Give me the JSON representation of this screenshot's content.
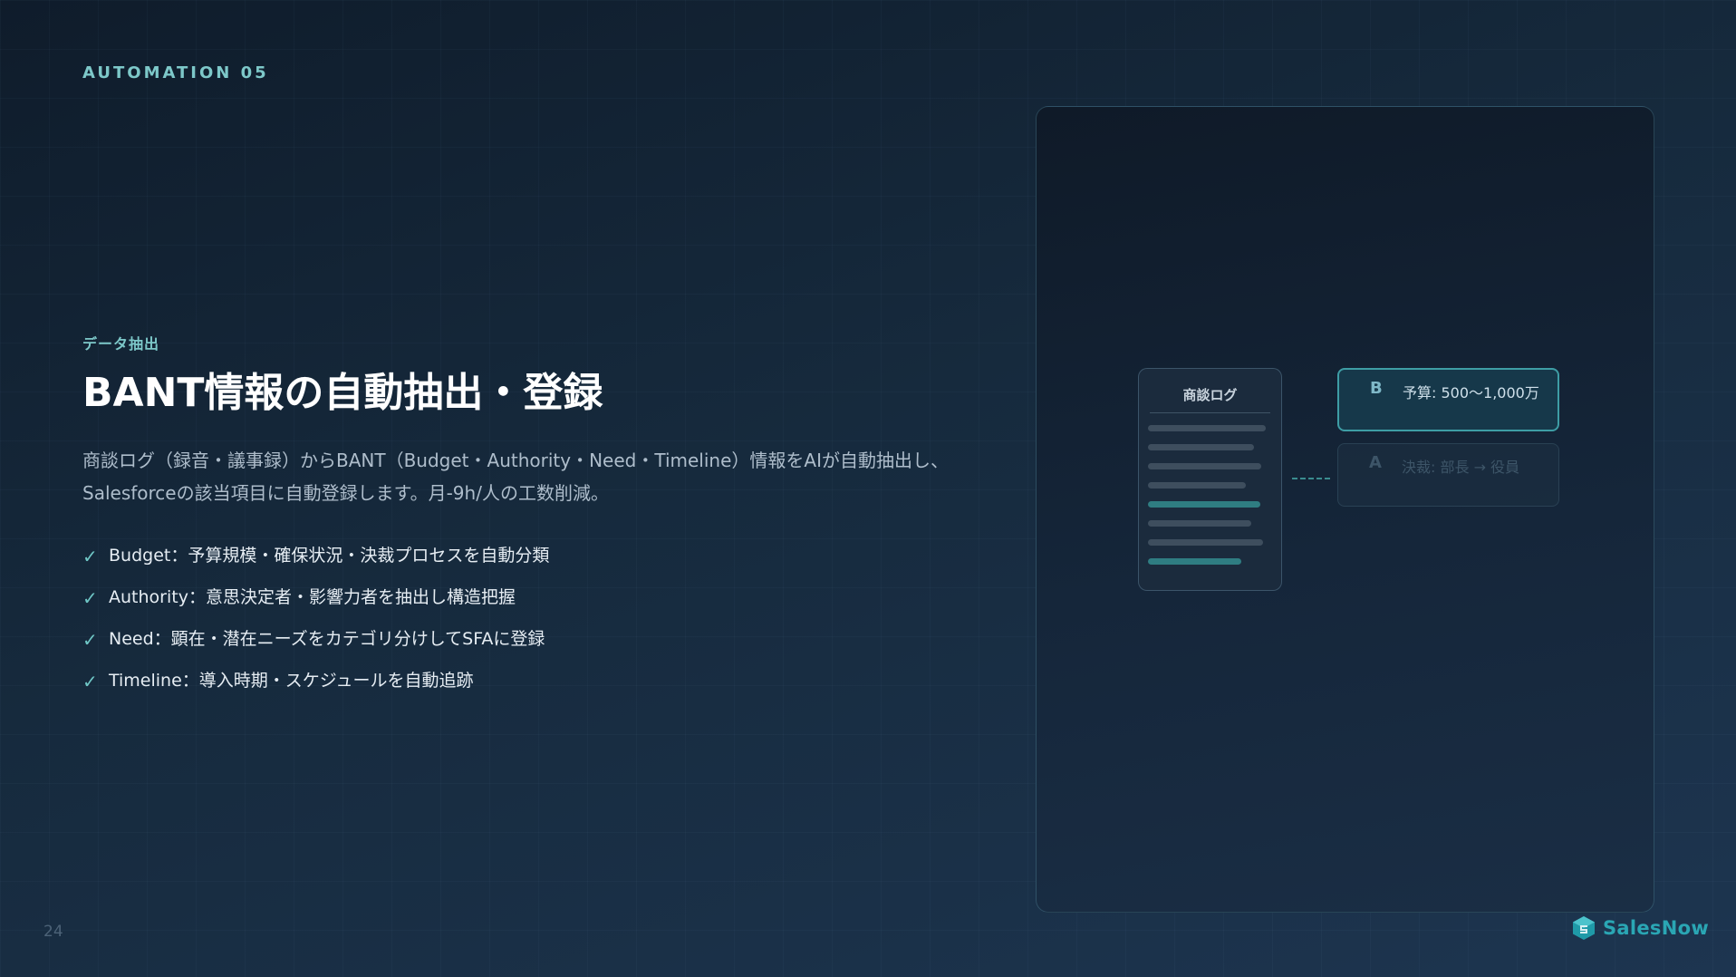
{
  "header": {
    "eyebrow": "AUTOMATION 05"
  },
  "content": {
    "kicker": "データ抽出",
    "title": "BANT情報の自動抽出・登録",
    "description": "商談ログ（録音・議事録）からBANT（Budget・Authority・Need・Timeline）情報をAIが自動抽出し、Salesforceの該当項目に自動登録します。月-9h/人の工数削減。",
    "bullets": [
      {
        "icon": "check-icon",
        "text": "Budget：予算規模・確保状況・決裁プロセスを自動分類"
      },
      {
        "icon": "check-icon",
        "text": "Authority：意思決定者・影響力者を抽出し構造把握"
      },
      {
        "icon": "check-icon",
        "text": "Need：顕在・潜在ニーズをカテゴリ分けしてSFAに登録"
      },
      {
        "icon": "check-icon",
        "text": "Timeline：導入時期・スケジュールを自動追跡"
      }
    ]
  },
  "diagram": {
    "document_title": "商談ログ",
    "cards": [
      {
        "letter": "B",
        "text": "予算: 500〜1,000万",
        "state": "active"
      },
      {
        "letter": "A",
        "text": "決裁: 部長 → 役員",
        "state": "faded"
      }
    ]
  },
  "footer": {
    "page_number": "24",
    "brand": "SalesNow"
  },
  "colors": {
    "accent": "#7dc8c9",
    "brand": "#2aa6b4",
    "background": "#162a3d"
  }
}
